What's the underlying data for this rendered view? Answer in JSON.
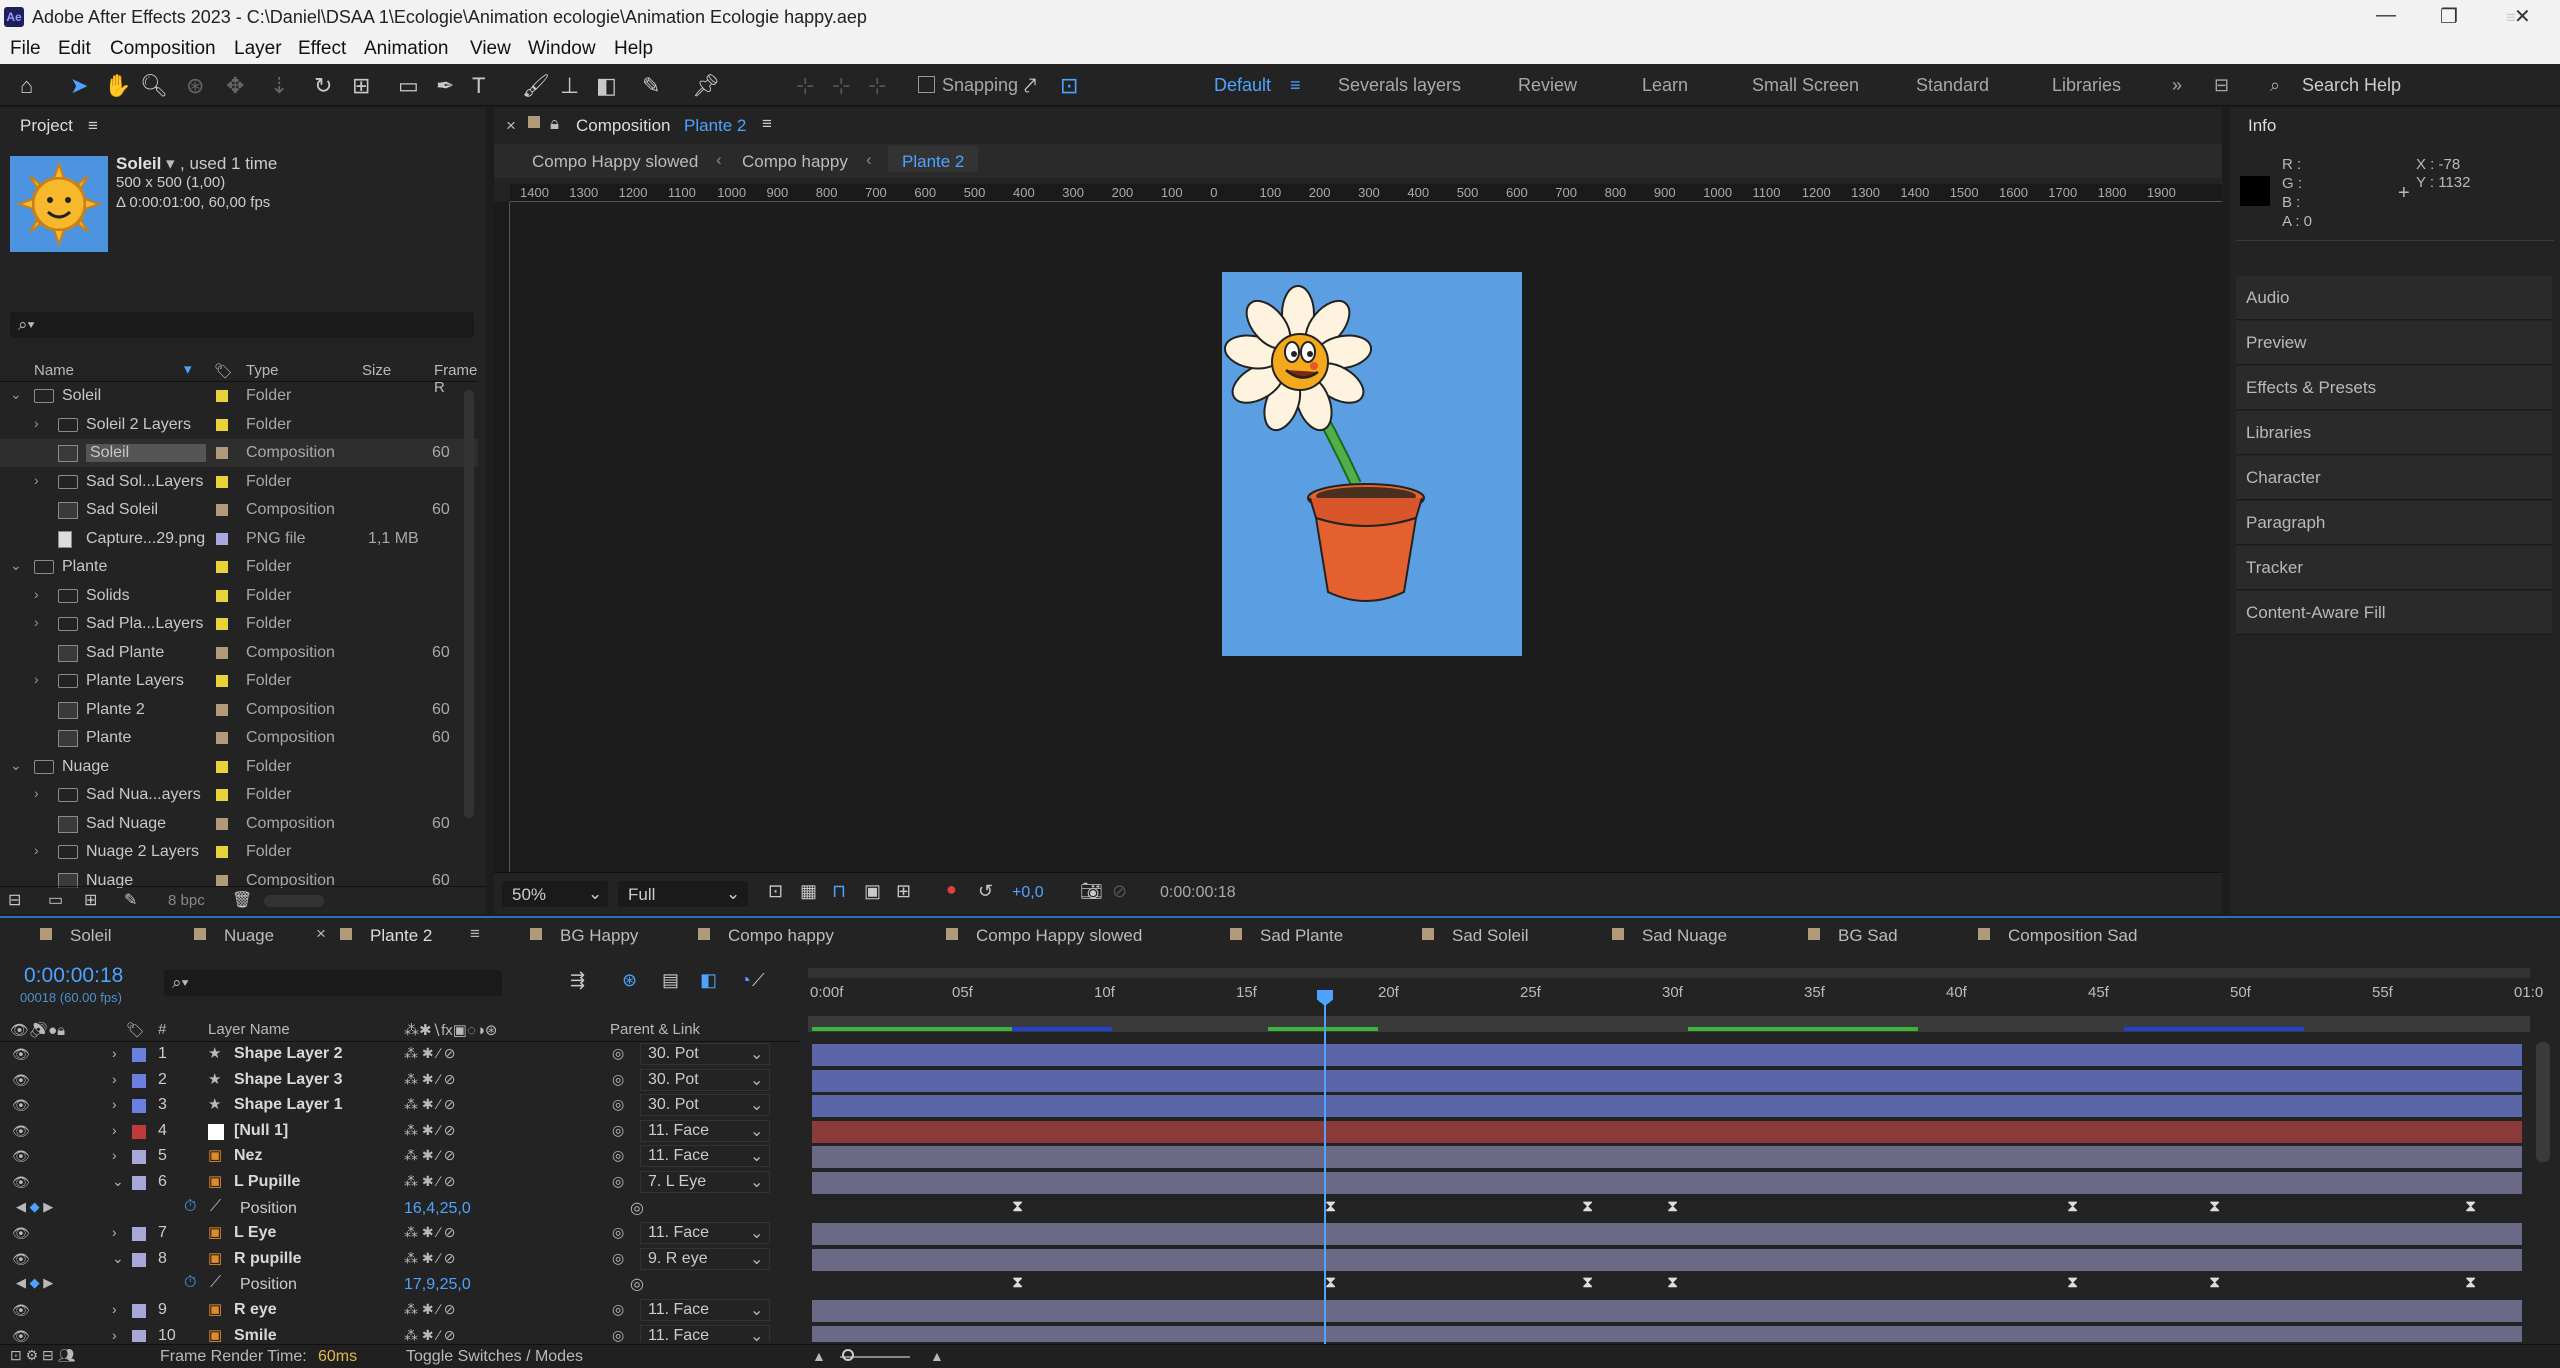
{
  "window": {
    "title": "Adobe After Effects 2023 - C:\\Daniel\\DSAA 1\\Ecologie\\Animation ecologie\\Animation Ecologie happy.aep"
  },
  "menu": [
    "File",
    "Edit",
    "Composition",
    "Layer",
    "Effect",
    "Animation",
    "View",
    "Window",
    "Help"
  ],
  "toolbar": {
    "snapping": "Snapping",
    "workspaces": [
      "Default",
      "Severals layers",
      "Review",
      "Learn",
      "Small Screen",
      "Standard",
      "Libraries"
    ],
    "search": "Search Help"
  },
  "project": {
    "title": "Project",
    "item_name": "Soleil",
    "used": ", used 1 time",
    "dims": "500 x 500 (1,00)",
    "duration": "Δ 0:00:01:00, 60,00 fps",
    "cols": [
      "Name",
      "Type",
      "Size",
      "Frame R"
    ],
    "rows": [
      {
        "name": "Soleil",
        "type": "Folder",
        "size": "",
        "kind": "folder",
        "indent": 0,
        "color": "#e8d43a"
      },
      {
        "name": "Soleil 2 Layers",
        "type": "Folder",
        "size": "",
        "kind": "folder",
        "indent": 1,
        "color": "#e8d43a"
      },
      {
        "name": "Soleil",
        "type": "Composition",
        "size": "60",
        "kind": "comp",
        "indent": 1,
        "color": "#b09a7a"
      },
      {
        "name": "Sad Sol...Layers",
        "type": "Folder",
        "size": "",
        "kind": "folder",
        "indent": 1,
        "color": "#e8d43a"
      },
      {
        "name": "Sad Soleil",
        "type": "Composition",
        "size": "60",
        "kind": "comp",
        "indent": 1,
        "color": "#b09a7a"
      },
      {
        "name": "Capture...29.png",
        "type": "PNG file",
        "size": "1,1 MB",
        "kind": "file",
        "indent": 1,
        "color": "#a8a8e0"
      },
      {
        "name": "Plante",
        "type": "Folder",
        "size": "",
        "kind": "folder",
        "indent": 0,
        "color": "#e8d43a"
      },
      {
        "name": "Solids",
        "type": "Folder",
        "size": "",
        "kind": "folder",
        "indent": 1,
        "color": "#e8d43a"
      },
      {
        "name": "Sad Pla...Layers",
        "type": "Folder",
        "size": "",
        "kind": "folder",
        "indent": 1,
        "color": "#e8d43a"
      },
      {
        "name": "Sad Plante",
        "type": "Composition",
        "size": "60",
        "kind": "comp",
        "indent": 1,
        "color": "#b09a7a"
      },
      {
        "name": "Plante Layers",
        "type": "Folder",
        "size": "",
        "kind": "folder",
        "indent": 1,
        "color": "#e8d43a"
      },
      {
        "name": "Plante 2",
        "type": "Composition",
        "size": "60",
        "kind": "comp",
        "indent": 1,
        "color": "#b09a7a"
      },
      {
        "name": "Plante",
        "type": "Composition",
        "size": "60",
        "kind": "comp",
        "indent": 1,
        "color": "#b09a7a"
      },
      {
        "name": "Nuage",
        "type": "Folder",
        "size": "",
        "kind": "folder",
        "indent": 0,
        "color": "#e8d43a"
      },
      {
        "name": "Sad Nua...ayers",
        "type": "Folder",
        "size": "",
        "kind": "folder",
        "indent": 1,
        "color": "#e8d43a"
      },
      {
        "name": "Sad Nuage",
        "type": "Composition",
        "size": "60",
        "kind": "comp",
        "indent": 1,
        "color": "#b09a7a"
      },
      {
        "name": "Nuage 2 Layers",
        "type": "Folder",
        "size": "",
        "kind": "folder",
        "indent": 1,
        "color": "#e8d43a"
      },
      {
        "name": "Nuage",
        "type": "Composition",
        "size": "60",
        "kind": "comp",
        "indent": 1,
        "color": "#b09a7a"
      }
    ],
    "bpc": "8 bpc"
  },
  "comp": {
    "label": "Composition",
    "name": "Plante 2",
    "crumbs": [
      "Compo Happy slowed",
      "Compo happy",
      "Plante 2"
    ],
    "ruler": [
      "1400",
      "1300",
      "1200",
      "1100",
      "1000",
      "900",
      "800",
      "700",
      "600",
      "500",
      "400",
      "300",
      "200",
      "100",
      "0",
      "100",
      "200",
      "300",
      "400",
      "500",
      "600",
      "700",
      "800",
      "900",
      "1000",
      "1100",
      "1200",
      "1300",
      "1400",
      "1500",
      "1600",
      "1700",
      "1800",
      "1900"
    ],
    "zoom": "50%",
    "quality": "Full",
    "exposure": "+0,0",
    "time": "0:00:00:18"
  },
  "info": {
    "title": "Info",
    "r": "R :",
    "g": "G :",
    "b": "B :",
    "a": "A :  0",
    "x": "X : -78",
    "y": "Y : 1132",
    "tabs": [
      "Audio",
      "Preview",
      "Effects & Presets",
      "Libraries",
      "Character",
      "Paragraph",
      "Tracker",
      "Content-Aware Fill"
    ]
  },
  "timeline": {
    "tabs": [
      "Soleil",
      "Nuage",
      "Plante 2",
      "BG Happy",
      "Compo happy",
      "Compo Happy slowed",
      "Sad Plante",
      "Sad Soleil",
      "Sad Nuage",
      "BG Sad",
      "Composition Sad"
    ],
    "time": "0:00:00:18",
    "frames": "00018 (60.00 fps)",
    "col_num": "#",
    "col_name": "Layer Name",
    "col_parent": "Parent & Link",
    "ticks": [
      "0:00f",
      "05f",
      "10f",
      "15f",
      "20f",
      "25f",
      "30f",
      "35f",
      "40f",
      "45f",
      "50f",
      "55f",
      "01:0"
    ],
    "layers": [
      {
        "num": "1",
        "name": "Shape Layer 2",
        "parent": "30. Pot",
        "color": "#6b7fe0",
        "bar": "#5a66a8",
        "icon": "star"
      },
      {
        "num": "2",
        "name": "Shape Layer 3",
        "parent": "30. Pot",
        "color": "#6b7fe0",
        "bar": "#5a66a8",
        "icon": "star"
      },
      {
        "num": "3",
        "name": "Shape Layer 1",
        "parent": "30. Pot",
        "color": "#6b7fe0",
        "bar": "#5a66a8",
        "icon": "star"
      },
      {
        "num": "4",
        "name": "[Null 1]",
        "parent": "11. Face",
        "color": "#c03a3a",
        "bar": "#8a3a3a",
        "icon": "null"
      },
      {
        "num": "5",
        "name": "Nez",
        "parent": "11. Face",
        "color": "#a8a8d8",
        "bar": "#6a6a86",
        "icon": "ai"
      },
      {
        "num": "6",
        "name": "L Pupille",
        "parent": "7. L Eye",
        "color": "#a8a8d8",
        "bar": "#6a6a86",
        "icon": "ai"
      },
      {
        "num": "7",
        "name": "L Eye",
        "parent": "11. Face",
        "color": "#a8a8d8",
        "bar": "#6a6a86",
        "icon": "ai"
      },
      {
        "num": "8",
        "name": "R pupille",
        "parent": "9. R eye",
        "color": "#a8a8d8",
        "bar": "#6a6a86",
        "icon": "ai"
      },
      {
        "num": "9",
        "name": "R eye",
        "parent": "11. Face",
        "color": "#a8a8d8",
        "bar": "#6a6a86",
        "icon": "ai"
      },
      {
        "num": "10",
        "name": "Smile",
        "parent": "11. Face",
        "color": "#a8a8d8",
        "bar": "#6a6a86",
        "icon": "ai"
      }
    ],
    "prop_label": "Position",
    "pos_l": "16,4,25,0",
    "pos_r": "17,9,25,0",
    "render_time_label": "Frame Render Time:",
    "render_time": "60ms",
    "toggle": "Toggle Switches / Modes"
  }
}
